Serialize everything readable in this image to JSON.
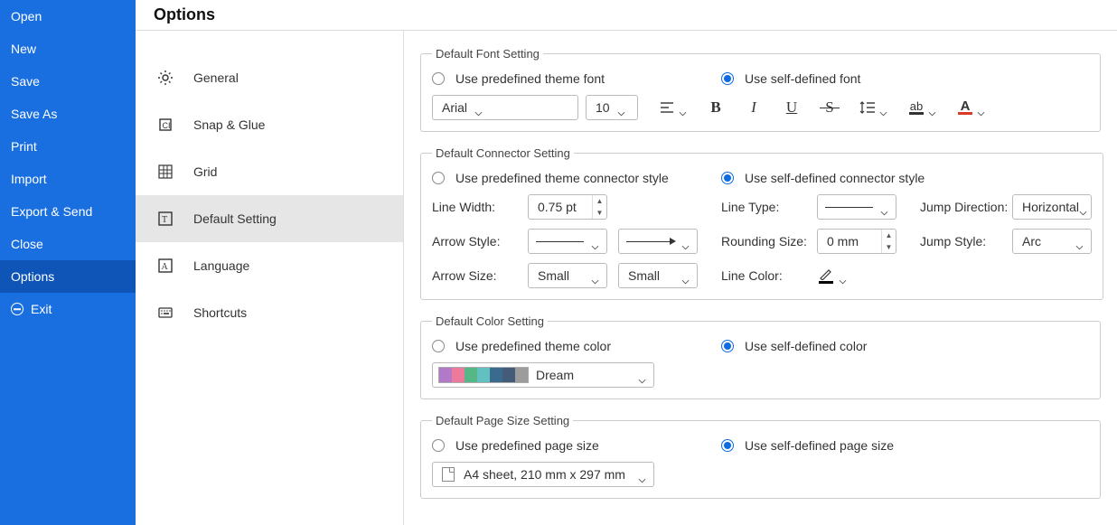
{
  "title": "Options",
  "file_menu": {
    "items": [
      "Open",
      "New",
      "Save",
      "Save As",
      "Print",
      "Import",
      "Export & Send",
      "Close",
      "Options",
      "Exit"
    ],
    "selected": "Options"
  },
  "tabs": {
    "items": [
      "General",
      "Snap & Glue",
      "Grid",
      "Default Setting",
      "Language",
      "Shortcuts"
    ],
    "selected": "Default Setting"
  },
  "font_section": {
    "legend": "Default Font Setting",
    "radio_a": "Use predefined theme font",
    "radio_b": "Use self-defined font",
    "selected": "b",
    "font_name": "Arial",
    "font_size": "10",
    "font_color": "#d83a2a"
  },
  "connector_section": {
    "legend": "Default Connector Setting",
    "radio_a": "Use predefined theme connector style",
    "radio_b": "Use self-defined connector style",
    "selected": "b",
    "line_width_label": "Line Width:",
    "line_width_value": "0.75 pt",
    "arrow_style_label": "Arrow Style:",
    "arrow_size_label": "Arrow Size:",
    "arrow_size_begin": "Small",
    "arrow_size_end": "Small",
    "line_type_label": "Line Type:",
    "rounding_label": "Rounding Size:",
    "rounding_value": "0 mm",
    "line_color_label": "Line Color:",
    "jump_dir_label": "Jump Direction:",
    "jump_dir_value": "Horizontal",
    "jump_style_label": "Jump Style:",
    "jump_style_value": "Arc"
  },
  "color_section": {
    "legend": "Default Color Setting",
    "radio_a": "Use predefined theme color",
    "radio_b": "Use self-defined color",
    "selected": "b",
    "theme_name": "Dream",
    "palette": [
      "#b279c8",
      "#ed7a9b",
      "#55b686",
      "#62c1c0",
      "#3a6a8e",
      "#445c78",
      "#9c9c9c"
    ]
  },
  "page_section": {
    "legend": "Default Page Size Setting",
    "radio_a": "Use predefined page size",
    "radio_b": "Use self-defined page size",
    "selected": "b",
    "page_size": "A4 sheet, 210 mm x 297 mm"
  }
}
